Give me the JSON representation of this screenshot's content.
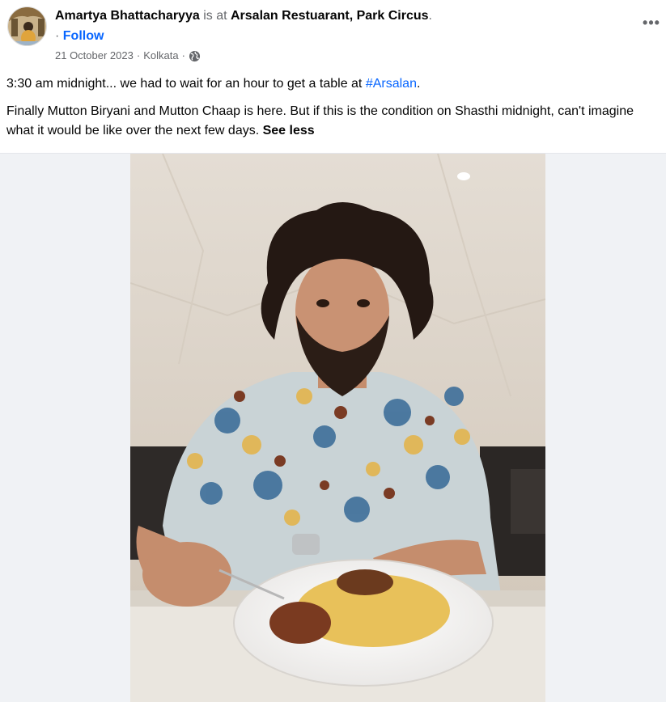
{
  "post": {
    "author": "Amartya Bhattacharyya",
    "is_at": "is at",
    "place": "Arsalan Restuarant, Park Circus",
    "place_suffix": ".",
    "follow_dot": "·",
    "follow": "Follow",
    "date": "21 October 2023",
    "sep1": "·",
    "location": "Kolkata",
    "sep2": "·",
    "audience_icon": "globe-icon",
    "more_icon": "more-options-icon",
    "more_label": "•••"
  },
  "content": {
    "line1_text": "3:30 am midnight... we had to wait for an hour to get a table at ",
    "line1_hashtag": "#Arsalan",
    "line1_end": ".",
    "line2_text": "Finally Mutton Biryani and Mutton Chaap is here. But if this is the condition on Shasthi midnight, can't imagine what it would be like over the next few days. ",
    "see_less": "See less"
  },
  "colors": {
    "link_blue": "#0866ff",
    "secondary_text": "#65676b",
    "primary_text": "#050505",
    "media_bg": "#f0f2f5"
  }
}
